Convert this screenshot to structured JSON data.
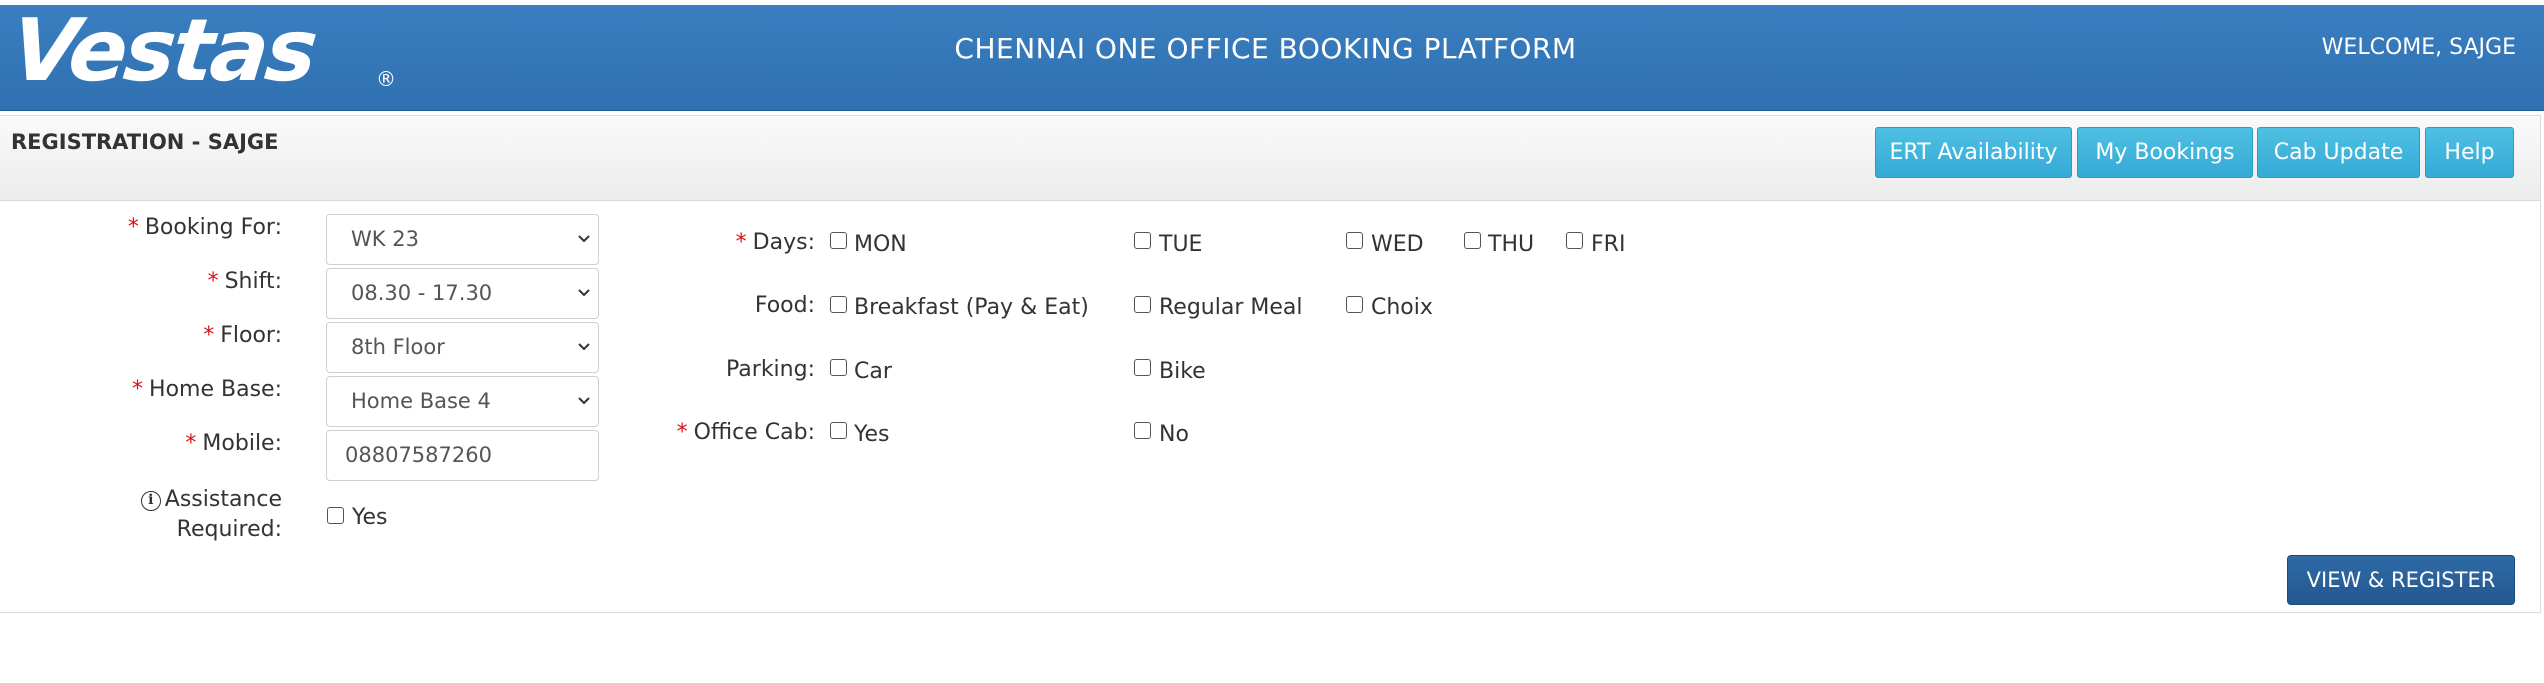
{
  "header": {
    "logo_text": "Vestas",
    "logo_reg": "®",
    "title": "CHENNAI ONE OFFICE BOOKING PLATFORM",
    "welcome": "WELCOME, SAJGE"
  },
  "panel": {
    "title": "REGISTRATION - SAJGE",
    "buttons": {
      "ert": "ERT Availability",
      "my_bookings": "My Bookings",
      "cab_update": "Cab Update",
      "help": "Help"
    }
  },
  "form": {
    "required_mark": "*",
    "booking_for": {
      "label": "Booking For:",
      "value": "WK 23"
    },
    "shift": {
      "label": "Shift:",
      "value": "08.30 - 17.30"
    },
    "floor": {
      "label": "Floor:",
      "value": "8th Floor"
    },
    "home_base": {
      "label": "Home Base:",
      "value": "Home Base 4"
    },
    "mobile": {
      "label": "Mobile:",
      "value": "08807587260"
    },
    "assistance": {
      "label_line1": "Assistance",
      "label_line2": "Required:",
      "info_glyph": "i",
      "option": "Yes",
      "checked": false
    },
    "days": {
      "label": "Days:",
      "options": [
        "MON",
        "TUE",
        "WED",
        "THU",
        "FRI"
      ]
    },
    "food": {
      "label": "Food:",
      "options": [
        "Breakfast (Pay & Eat)",
        "Regular Meal",
        "Choix"
      ]
    },
    "parking": {
      "label": "Parking:",
      "options": [
        "Car",
        "Bike"
      ]
    },
    "office_cab": {
      "label": "Office Cab:",
      "options": [
        "Yes",
        "No"
      ]
    }
  },
  "actions": {
    "view_register": "VIEW & REGISTER"
  },
  "colors": {
    "header_blue": "#3578b9",
    "info_button": "#3db4dc",
    "primary_button": "#285e98",
    "required_red": "#d9121a"
  }
}
